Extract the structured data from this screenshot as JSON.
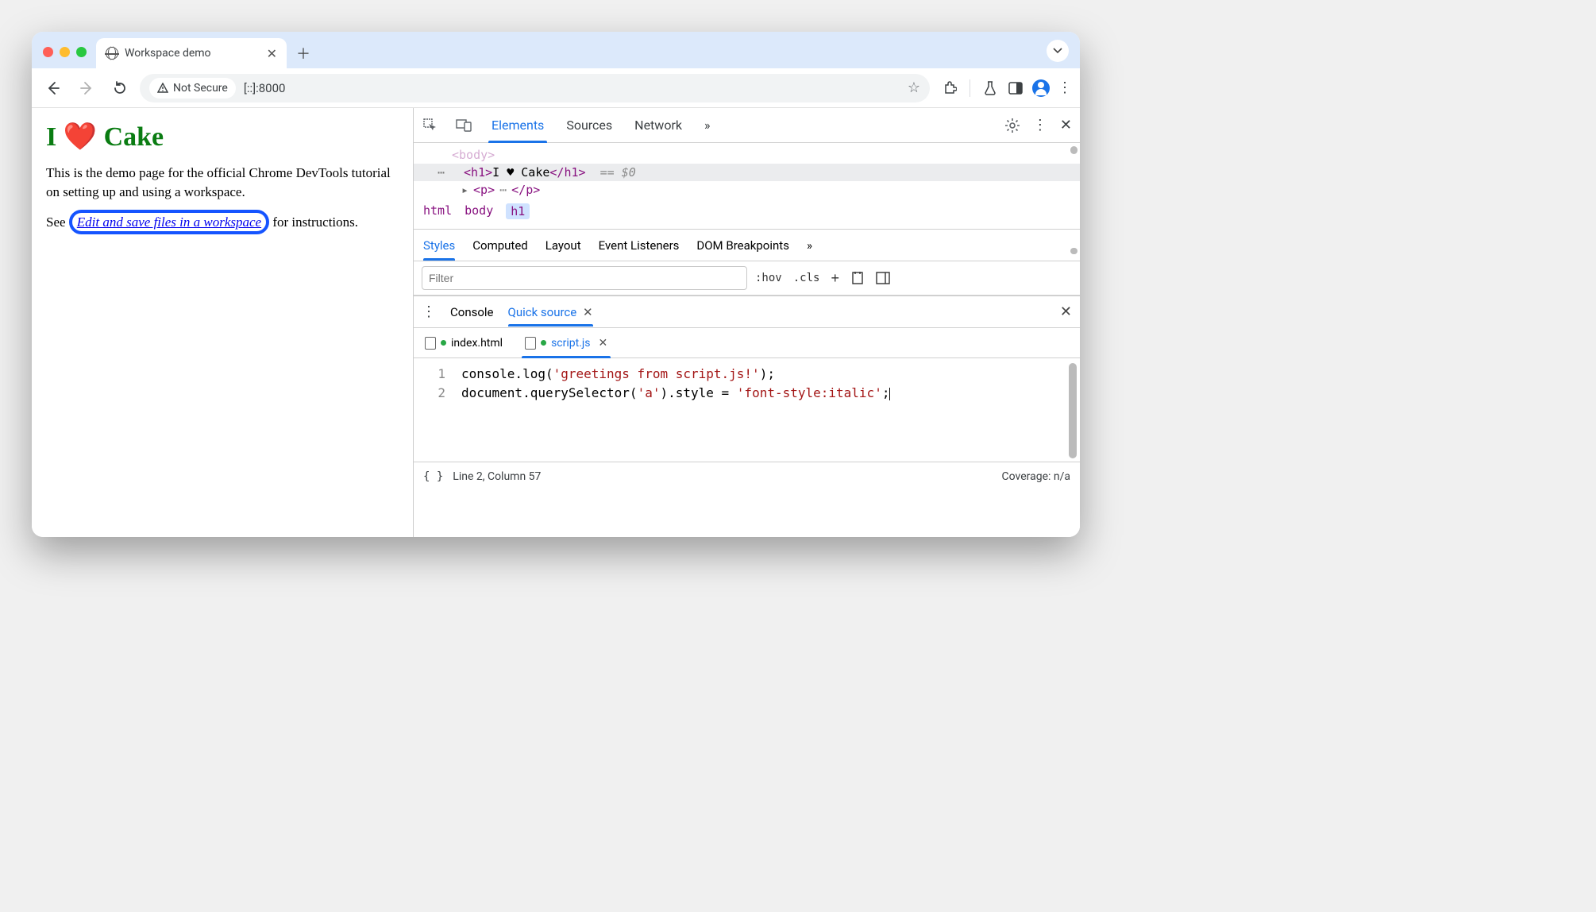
{
  "tab": {
    "title": "Workspace demo"
  },
  "omnibox": {
    "security_label": "Not Secure",
    "url": "[::]:8000"
  },
  "page": {
    "h1": "I ❤️ Cake",
    "p1": "This is the demo page for the official Chrome DevTools tutorial on setting up and using a workspace.",
    "p2_prefix": "See ",
    "link_text": "Edit and save files in a workspace",
    "p2_suffix": " for instructions."
  },
  "devtools": {
    "panels": [
      "Elements",
      "Sources",
      "Network"
    ],
    "more": "»",
    "dom": {
      "above": "<body>",
      "selected_open": "<h1>",
      "selected_text": "I ♥ Cake",
      "selected_close": "</h1>",
      "eq": "== $0",
      "below_open": "<p>",
      "below_close": "</p>"
    },
    "breadcrumb": [
      "html",
      "body",
      "h1"
    ],
    "styles_tabs": [
      "Styles",
      "Computed",
      "Layout",
      "Event Listeners",
      "DOM Breakpoints"
    ],
    "styles_more": "»",
    "filter_placeholder": "Filter",
    "styles_actions": {
      "hov": ":hov",
      "cls": ".cls",
      "plus": "+"
    },
    "drawer": {
      "tabs": [
        "Console",
        "Quick source"
      ],
      "files": [
        "index.html",
        "script.js"
      ],
      "code": {
        "lines": [
          "1",
          "2"
        ],
        "l1": "console.log('greetings from script.js!');",
        "l2": "document.querySelector('a').style = 'font-style:italic';"
      },
      "status_pos": "Line 2, Column 57",
      "coverage": "Coverage: n/a"
    }
  }
}
